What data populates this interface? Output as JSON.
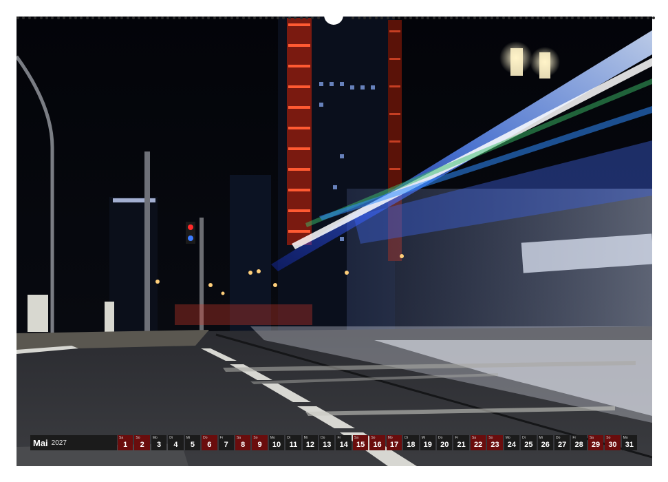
{
  "calendar": {
    "month": "Mai",
    "year": "2027",
    "days": [
      {
        "wd": "Sa",
        "d": "1",
        "red": true
      },
      {
        "wd": "So",
        "d": "2",
        "red": true
      },
      {
        "wd": "Mo",
        "d": "3",
        "red": false
      },
      {
        "wd": "Di",
        "d": "4",
        "red": false
      },
      {
        "wd": "Mi",
        "d": "5",
        "red": false
      },
      {
        "wd": "Do",
        "d": "6",
        "red": true
      },
      {
        "wd": "Fr",
        "d": "7",
        "red": false
      },
      {
        "wd": "Sa",
        "d": "8",
        "red": true
      },
      {
        "wd": "So",
        "d": "9",
        "red": true
      },
      {
        "wd": "Mo",
        "d": "10",
        "red": false
      },
      {
        "wd": "Di",
        "d": "11",
        "red": false
      },
      {
        "wd": "Mi",
        "d": "12",
        "red": false
      },
      {
        "wd": "Do",
        "d": "13",
        "red": false
      },
      {
        "wd": "Fr",
        "d": "14",
        "red": false
      },
      {
        "wd": "Sa",
        "d": "15",
        "red": true
      },
      {
        "wd": "So",
        "d": "16",
        "red": true
      },
      {
        "wd": "Mo",
        "d": "17",
        "red": true
      },
      {
        "wd": "Di",
        "d": "18",
        "red": false
      },
      {
        "wd": "Mi",
        "d": "19",
        "red": false
      },
      {
        "wd": "Do",
        "d": "20",
        "red": false
      },
      {
        "wd": "Fr",
        "d": "21",
        "red": false
      },
      {
        "wd": "Sa",
        "d": "22",
        "red": true
      },
      {
        "wd": "So",
        "d": "23",
        "red": true
      },
      {
        "wd": "Mo",
        "d": "24",
        "red": false
      },
      {
        "wd": "Di",
        "d": "25",
        "red": false
      },
      {
        "wd": "Mi",
        "d": "26",
        "red": false
      },
      {
        "wd": "Do",
        "d": "27",
        "red": false
      },
      {
        "wd": "Fr",
        "d": "28",
        "red": false
      },
      {
        "wd": "Sa",
        "d": "29",
        "red": true
      },
      {
        "wd": "So",
        "d": "30",
        "red": true
      },
      {
        "wd": "Mo",
        "d": "31",
        "red": false
      }
    ]
  },
  "colors": {
    "sky": "#05070c",
    "light_trail": "#2f6cff",
    "tower_lights": "#e8452a",
    "calendar_bar": "#1b1b1b",
    "weekend_red": "#6a0d0d"
  }
}
